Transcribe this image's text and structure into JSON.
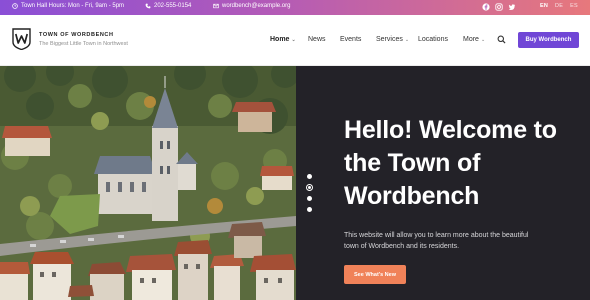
{
  "topbar": {
    "hours": "Town Hall Hours: Mon - Fri, 9am - 5pm",
    "phone": "202-555-0154",
    "email": "wordbench@example.org",
    "social": [
      "facebook-icon",
      "instagram-icon",
      "twitter-icon"
    ],
    "languages": [
      "EN",
      "DE",
      "ES"
    ],
    "active_language": "EN"
  },
  "header": {
    "brand_title": "TOWN OF WORDBENCH",
    "brand_sub": "The Biggest Little Town in Northwest",
    "logo_letter": "W",
    "nav": [
      {
        "label": "Home"
      },
      {
        "label": "News"
      },
      {
        "label": "Events"
      },
      {
        "label": "Services"
      },
      {
        "label": "Locations"
      },
      {
        "label": "More"
      }
    ],
    "cta": "Buy Wordbench"
  },
  "hero": {
    "headline_1": "Hello!",
    "headline_2": " Welcome to the Town of ",
    "headline_3": "Wordbench",
    "lead": "This website will allow you to learn more about the beautiful town of Wordbench and its residents.",
    "button": "See What's New",
    "slide_count": 4,
    "active_slide": 1
  },
  "colors": {
    "accent": "#7046d6",
    "cta_orange": "#f08259",
    "dark_panel": "#232228"
  }
}
